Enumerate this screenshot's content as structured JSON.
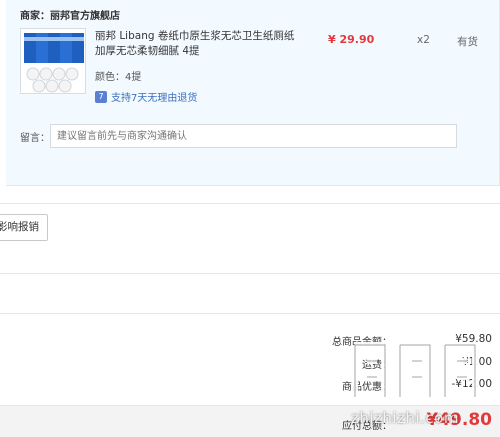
{
  "shop": {
    "label": "商家：",
    "name": "丽邦官方旗舰店"
  },
  "product": {
    "image_icon": "product-thumbnail-icon",
    "title": "丽邦 Libang 卷纸巾原生浆无芯卫生纸厕纸加厚无芯柔韧细腻 4提",
    "variant": "颜色：4提",
    "return_badge": "7",
    "return_policy": "支持7天无理由退货",
    "price": "¥ 29.90",
    "quantity": "x2",
    "stock": "有货"
  },
  "message": {
    "label": "留言：",
    "placeholder": "建议留言前先与商家沟通确认"
  },
  "invoice_button": {
    "label": "影响报销"
  },
  "summary": {
    "subtotal_label": "总商品金额：",
    "subtotal_value": "¥59.80",
    "row2_label": "运费：",
    "row2_value": "¥1.00",
    "row3_label": "商品优惠：",
    "row3_value": "-¥12.00"
  },
  "total": {
    "label": "应付总额：",
    "value": "¥49.80"
  },
  "watermark": {
    "text": "zhizhizhi.com"
  },
  "colors": {
    "price_red": "#e4393c",
    "panel_bg": "#f2f9ff",
    "link_blue": "#3c6fbf"
  }
}
